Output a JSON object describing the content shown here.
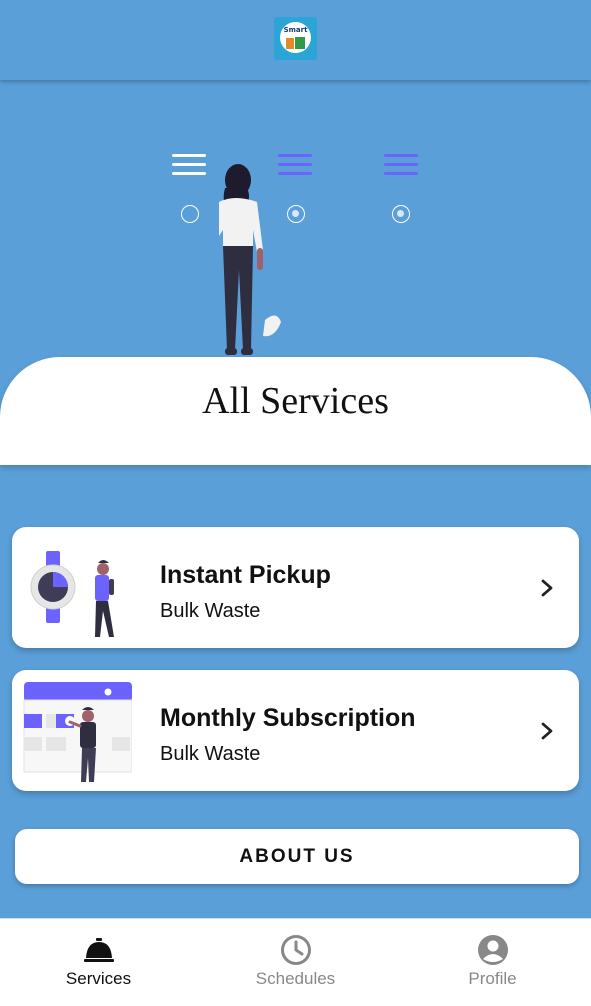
{
  "header": {
    "logo_text": "Smart"
  },
  "hero": {
    "accent_color": "#6c63ff"
  },
  "section": {
    "title": "All Services"
  },
  "services": [
    {
      "title": "Instant Pickup",
      "subtitle": "Bulk Waste",
      "illustration": "stopwatch-person-illustration"
    },
    {
      "title": "Monthly Subscription",
      "subtitle": "Bulk Waste",
      "illustration": "calendar-person-illustration"
    }
  ],
  "about": {
    "label": "ABOUT US"
  },
  "bottom_nav": {
    "items": [
      {
        "label": "Services",
        "icon": "room-service-bell-icon",
        "active": true
      },
      {
        "label": "Schedules",
        "icon": "clock-icon",
        "active": false
      },
      {
        "label": "Profile",
        "icon": "account-circle-icon",
        "active": false
      }
    ]
  },
  "colors": {
    "background": "#5a9fd8",
    "card": "#ffffff",
    "text": "#111111",
    "inactive": "#888888"
  }
}
